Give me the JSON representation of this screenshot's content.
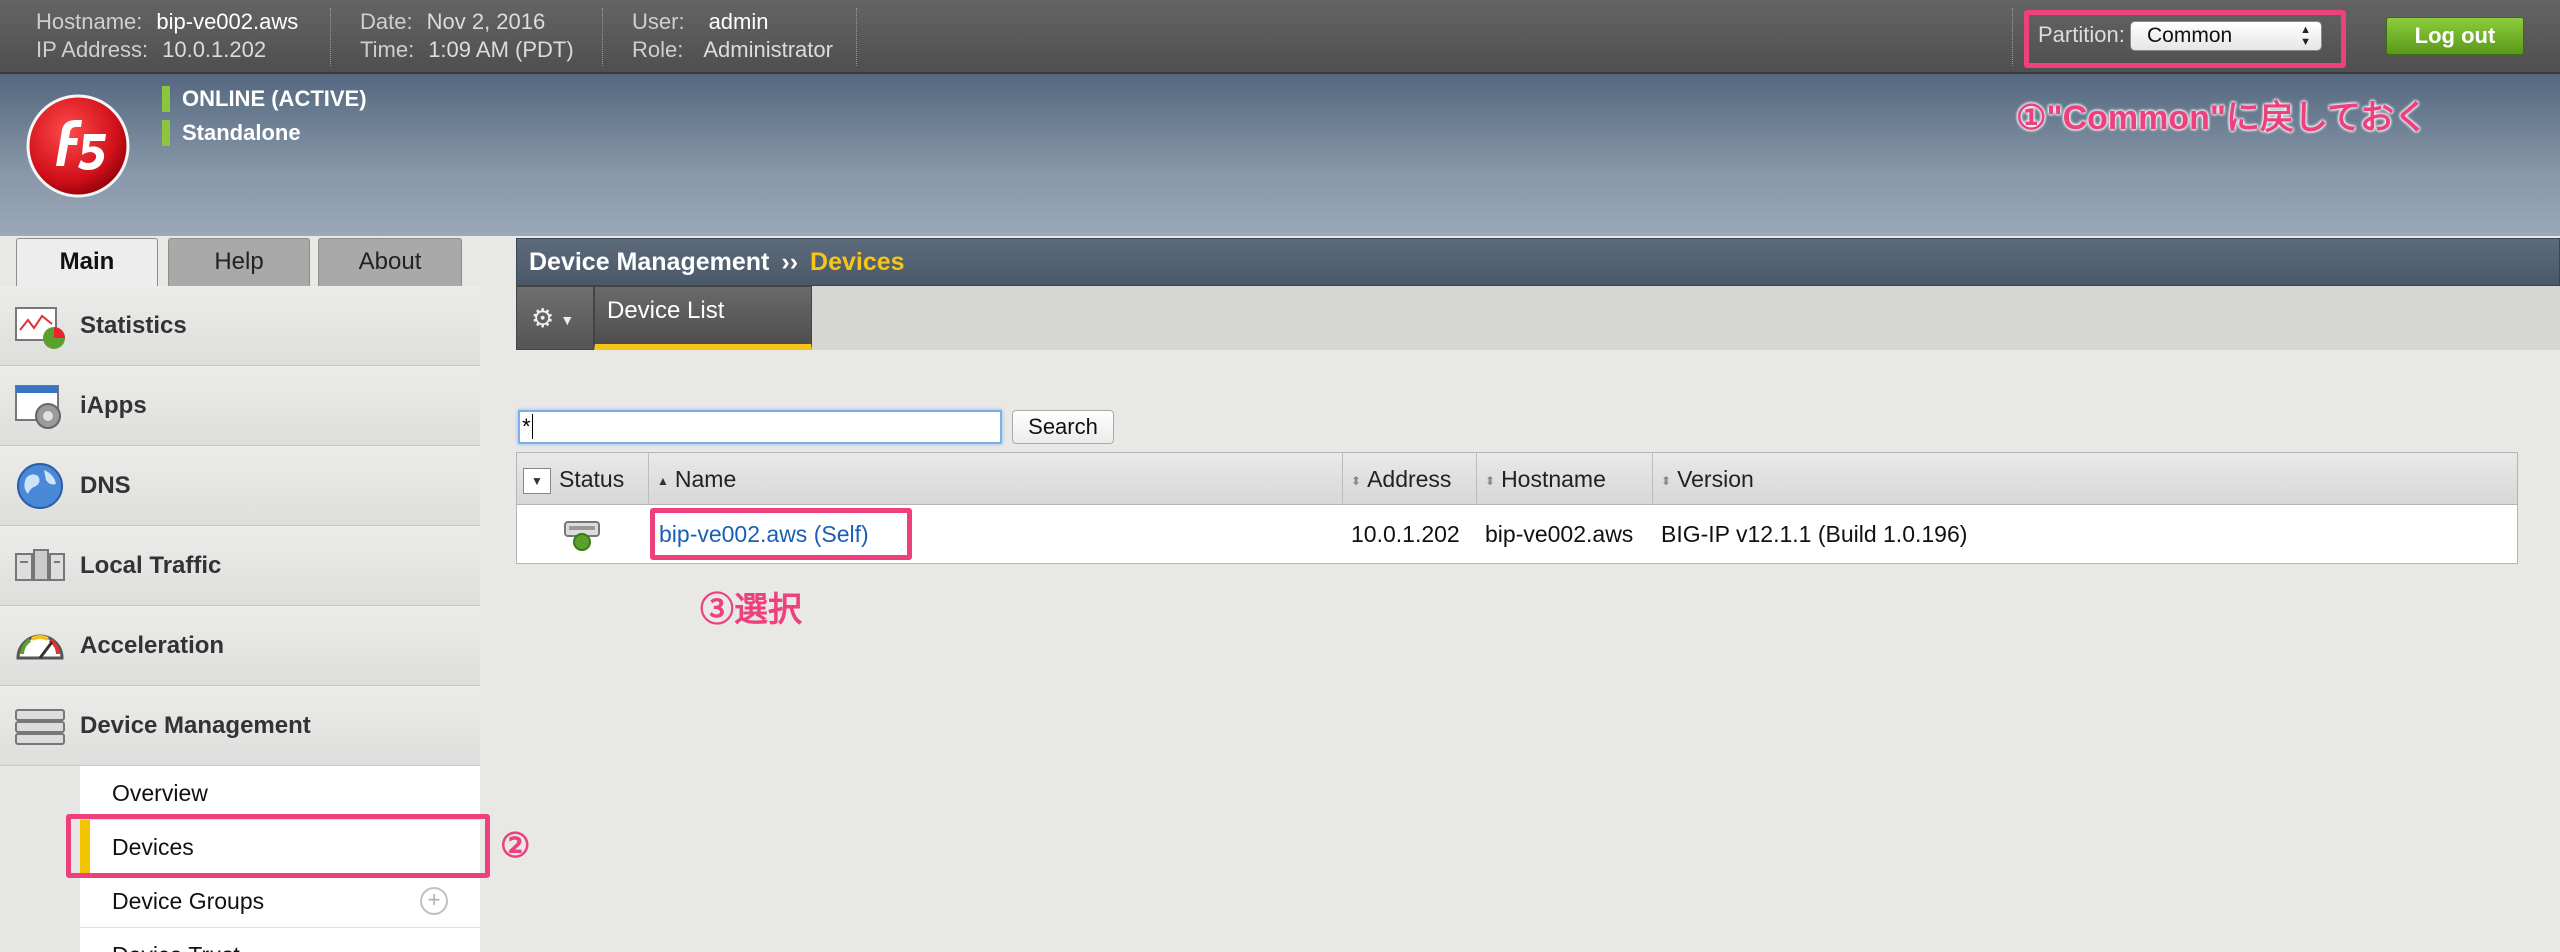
{
  "topbar": {
    "hostname_label": "Hostname:",
    "hostname": "bip-ve002.aws",
    "ip_label": "IP Address:",
    "ip": "10.0.1.202",
    "date_label": "Date:",
    "date": "Nov 2, 2016",
    "time_label": "Time:",
    "time": "1:09 AM (PDT)",
    "user_label": "User:",
    "user": "admin",
    "role_label": "Role:",
    "role": "Administrator",
    "partition_label": "Partition:",
    "partition_value": "Common",
    "logout_label": "Log out"
  },
  "banner": {
    "status_online": "ONLINE (ACTIVE)",
    "status_mode": "Standalone",
    "logo_text": "f5"
  },
  "annotations": {
    "step1": "①\"Common\"に戻しておく",
    "step2": "②",
    "step3": "③選択",
    "highlight_color": "#ee3f7e"
  },
  "tabs": [
    "Main",
    "Help",
    "About"
  ],
  "sidebar": {
    "items": [
      {
        "label": "Statistics",
        "icon": "statistics-icon"
      },
      {
        "label": "iApps",
        "icon": "iapps-icon"
      },
      {
        "label": "DNS",
        "icon": "dns-icon"
      },
      {
        "label": "Local Traffic",
        "icon": "local-traffic-icon"
      },
      {
        "label": "Acceleration",
        "icon": "acceleration-icon"
      },
      {
        "label": "Device Management",
        "icon": "device-management-icon"
      }
    ],
    "submenu": [
      "Overview",
      "Devices",
      "Device Groups",
      "Device Trust"
    ]
  },
  "content": {
    "breadcrumb_parent": "Device Management",
    "breadcrumb_sep": "››",
    "breadcrumb_current": "Devices",
    "subtab": "Device List",
    "search_value": "*",
    "search_button": "Search",
    "columns": [
      "Status",
      "Name",
      "Address",
      "Hostname",
      "Version"
    ],
    "rows": [
      {
        "status_icon": "device-online-icon",
        "name": "bip-ve002.aws (Self)",
        "address": "10.0.1.202",
        "hostname": "bip-ve002.aws",
        "version": "BIG-IP v12.1.1 (Build 1.0.196)"
      }
    ]
  },
  "colors": {
    "accent_yellow": "#f5c518",
    "status_green": "#8cc63f",
    "logout_green": "#6fb02a",
    "link_blue": "#1a5fb4"
  }
}
